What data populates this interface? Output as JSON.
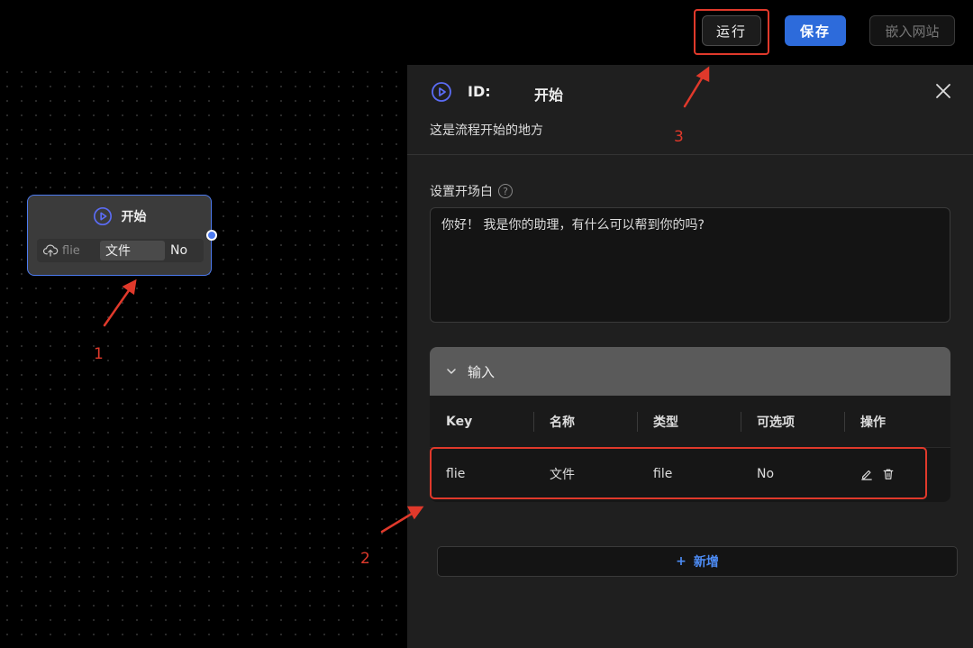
{
  "toolbar": {
    "run_label": "运行",
    "save_label": "保存",
    "embed_label": "嵌入网站"
  },
  "node": {
    "title": "开始",
    "row_key": "flie",
    "row_type": "文件",
    "row_optional": "No"
  },
  "panel": {
    "id_label": "ID:",
    "node_name": "开始",
    "description": "这是流程开始的地方",
    "greeting_label": "设置开场白",
    "help_symbol": "?",
    "greeting_value": "你好！ 我是你的助理，有什么可以帮到你的吗?",
    "inputs_section": {
      "title": "输入",
      "columns": [
        "Key",
        "名称",
        "类型",
        "可选项",
        "操作"
      ],
      "rows": [
        {
          "key": "flie",
          "name": "文件",
          "type": "file",
          "optional": "No"
        }
      ]
    },
    "add_label": "新增",
    "add_symbol": "+"
  },
  "annotations": [
    "1",
    "2",
    "3"
  ],
  "colors": {
    "accent_blue": "#2d6bdb",
    "node_border": "#4d7bf0",
    "annotation_red": "#e0392b",
    "panel_bg": "#1f1f1f"
  },
  "icons": {
    "node_play": "play-circle-icon",
    "node_upload": "cloud-upload-icon",
    "close": "close-icon",
    "collapse": "chevron-down-icon",
    "edit": "edit-icon",
    "delete": "trash-icon"
  }
}
